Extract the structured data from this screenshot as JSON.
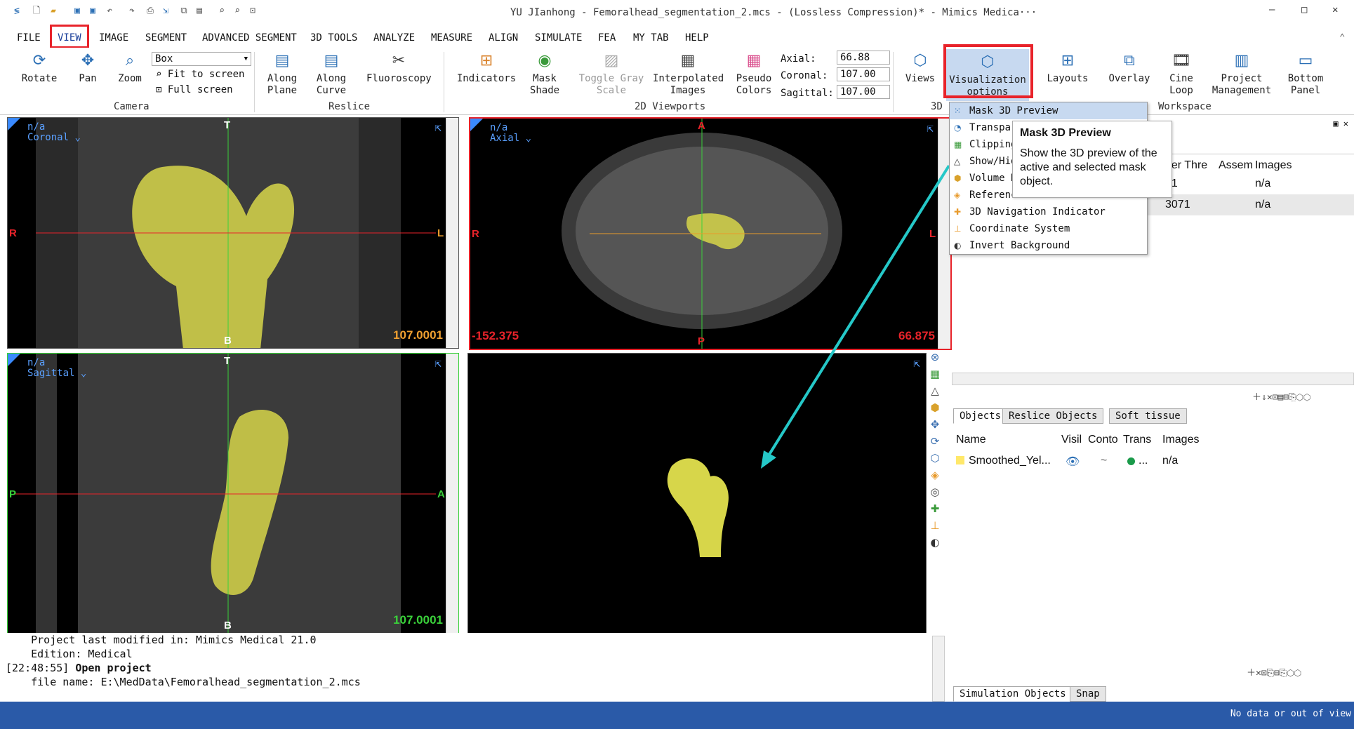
{
  "window": {
    "title": "YU JIanhong - Femoralhead_segmentation_2.mcs -  (Lossless Compression)* - Mimics Medica···",
    "controls": [
      "–",
      "□",
      "✕"
    ]
  },
  "menu": [
    "FILE",
    "VIEW",
    "IMAGE",
    "SEGMENT",
    "ADVANCED SEGMENT",
    "3D TOOLS",
    "ANALYZE",
    "MEASURE",
    "ALIGN",
    "SIMULATE",
    "FEA",
    "MY TAB",
    "HELP"
  ],
  "ribbon": {
    "camera": {
      "rotate": "Rotate",
      "pan": "Pan",
      "zoom": "Zoom",
      "box_value": "Box",
      "fit": "Fit to screen",
      "full": "Full screen",
      "group": "Camera"
    },
    "reslice": {
      "along_plane_1": "Along",
      "along_plane_2": "Plane",
      "along_curve_1": "Along",
      "along_curve_2": "Curve",
      "fluoroscopy": "Fluoroscopy",
      "group": "Reslice"
    },
    "viewports2d": {
      "indicators": "Indicators",
      "mask_shade_1": "Mask",
      "mask_shade_2": "Shade",
      "toggle_1": "Toggle Gray",
      "toggle_2": "Scale",
      "interp_1": "Interpolated",
      "interp_2": "Images",
      "pseudo_1": "Pseudo",
      "pseudo_2": "Colors",
      "axial_label": "Axial:",
      "axial_value": "66.88",
      "coronal_label": "Coronal:",
      "coronal_value": "107.00",
      "sagittal_label": "Sagittal:",
      "sagittal_value": "107.00",
      "group": "2D Viewports"
    },
    "threed": {
      "views": "Views",
      "vis_1": "Visualization",
      "vis_2": "options",
      "group": "3D"
    },
    "workspace": {
      "layouts": "Layouts",
      "overlay": "Overlay",
      "cine_1": "Cine",
      "cine_2": "Loop",
      "proj_1": "Project",
      "proj_2": "Management",
      "bottom_1": "Bottom",
      "bottom_2": "Panel",
      "group": "Workspace"
    }
  },
  "viewports": {
    "coronal": {
      "label_1": "n/a",
      "label_2": "Coronal",
      "value": "107.0001",
      "top": "T",
      "bottom": "B",
      "left": "R",
      "right": "L"
    },
    "axial": {
      "label_1": "n/a",
      "label_2": "Axial",
      "value": "66.875",
      "left_value": "-152.375",
      "top": "A",
      "bottom": "P",
      "left": "R",
      "right": "L"
    },
    "sagittal": {
      "label_1": "n/a",
      "label_2": "Sagittal",
      "value": "107.0001",
      "top": "T",
      "bottom": "B",
      "left": "P",
      "right": "A"
    }
  },
  "dropdown": [
    "Mask 3D Preview",
    "Transpar",
    "Clipping",
    "Show/Hid",
    "Volume R",
    "Referenc",
    "3D Navigation Indicator",
    "Coordinate System",
    "Invert Background"
  ],
  "tooltip": {
    "title": "Mask 3D Preview",
    "desc": "Show the 3D preview of the active and selected mask object."
  },
  "masks_table": {
    "headers": [
      "ber Thre",
      "Assem",
      "Images"
    ],
    "rows": [
      [
        "71",
        "",
        "n/a"
      ],
      [
        "3071",
        "",
        "n/a"
      ]
    ]
  },
  "objects": {
    "tabs": [
      "Objects",
      "Reslice Objects",
      "Soft tissue"
    ],
    "headers": [
      "Name",
      "Visil",
      "Conto",
      "Trans",
      "Images"
    ],
    "rows": [
      {
        "name": "Smoothed_Yel...",
        "visible": "👁",
        "contour": "~",
        "trans": "...",
        "images": "n/a"
      }
    ],
    "bottom_tabs": [
      "Simulation Objects",
      "Snap"
    ]
  },
  "log": {
    "line1": "    Project last modified in: Mimics Medical 21.0",
    "line2": "    Edition: Medical",
    "time": "[22:48:55]",
    "action": "Open project",
    "line4": "    file name: E:\\MedData\\Femoralhead_segmentation_2.mcs"
  },
  "status": {
    "right": "No data or out of view"
  },
  "colors": {
    "accent_red": "#e8232a",
    "mask_yellow": "#d7d64a",
    "status_blue": "#2a5aa8",
    "highlight": "#c7d9f0"
  }
}
